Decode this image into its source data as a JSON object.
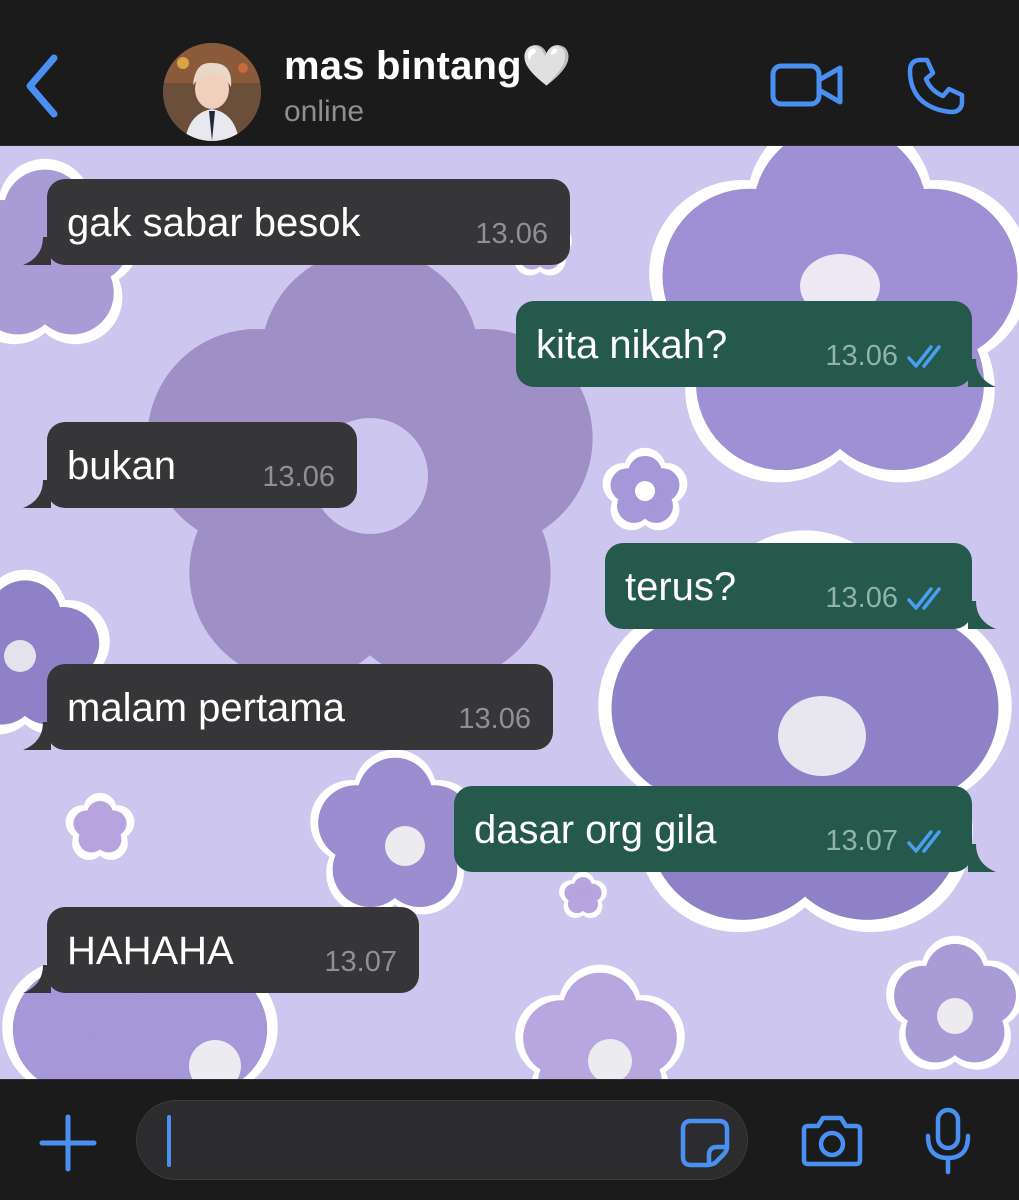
{
  "header": {
    "contact_name": "mas bintang🤍",
    "status": "online",
    "back_icon": "chevron-left-icon",
    "video_icon": "video-camera-icon",
    "call_icon": "phone-icon"
  },
  "messages": [
    {
      "direction": "incoming",
      "text": "gak sabar besok",
      "time": "13.06"
    },
    {
      "direction": "outgoing",
      "text": "kita nikah?",
      "time": "13.06",
      "read": true
    },
    {
      "direction": "incoming",
      "text": "bukan",
      "time": "13.06"
    },
    {
      "direction": "outgoing",
      "text": "terus?",
      "time": "13.06",
      "read": true
    },
    {
      "direction": "incoming",
      "text": "malam pertama",
      "time": "13.06"
    },
    {
      "direction": "outgoing",
      "text": "dasar org gila",
      "time": "13.07",
      "read": true
    },
    {
      "direction": "incoming",
      "text": "HAHAHA",
      "time": "13.07"
    }
  ],
  "composer": {
    "plus_icon": "plus-icon",
    "sticker_icon": "sticker-icon",
    "camera_icon": "camera-icon",
    "mic_icon": "microphone-icon",
    "value": ""
  },
  "colors": {
    "accent": "#4a90f2",
    "incoming_bubble": "#363638",
    "outgoing_bubble": "#24594b",
    "wallpaper": "#cdc6ef"
  }
}
